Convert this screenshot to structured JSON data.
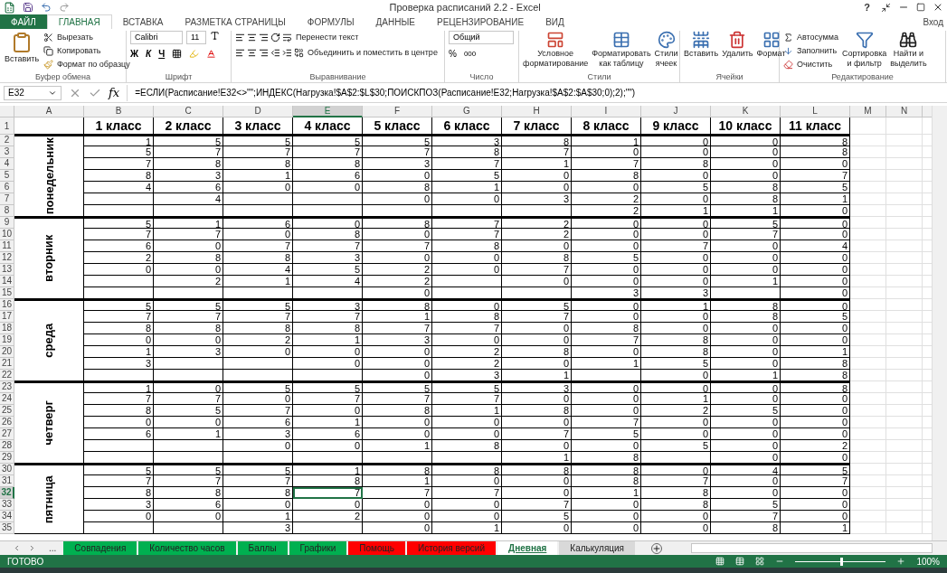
{
  "window": {
    "title": "Проверка расписаний 2.2 - Excel",
    "help": "?"
  },
  "ribbon_tabs": [
    {
      "label": "ФАЙЛ",
      "kind": "file",
      "selected": false
    },
    {
      "label": "ГЛАВНАЯ",
      "kind": "tab",
      "selected": true
    },
    {
      "label": "ВСТАВКА",
      "kind": "tab",
      "selected": false
    },
    {
      "label": "РАЗМЕТКА СТРАНИЦЫ",
      "kind": "tab",
      "selected": false
    },
    {
      "label": "ФОРМУЛЫ",
      "kind": "tab",
      "selected": false
    },
    {
      "label": "ДАННЫЕ",
      "kind": "tab",
      "selected": false
    },
    {
      "label": "РЕЦЕНЗИРОВАНИЕ",
      "kind": "tab",
      "selected": false
    },
    {
      "label": "ВИД",
      "kind": "tab",
      "selected": false
    }
  ],
  "sign_in": "Вход",
  "clipboard": {
    "title": "Буфер обмена",
    "paste": "Вставить",
    "cut": "Вырезать",
    "copy": "Копировать",
    "format_painter": "Формат по образцу"
  },
  "font": {
    "title": "Шрифт",
    "name": "Calibri",
    "size": "11",
    "bold": "Ж",
    "italic": "К",
    "underline": "Ч"
  },
  "alignment": {
    "title": "Выравнивание",
    "wrap": "Перенести текст",
    "merge": "Объединить и поместить в центре"
  },
  "number": {
    "title": "Число",
    "format": "Общий",
    "percent": "%",
    "thousands": "000"
  },
  "styles": {
    "title": "Стили",
    "buttons": [
      {
        "lines": [
          "Условное",
          "форматирование"
        ]
      },
      {
        "lines": [
          "Форматировать",
          "как таблицу"
        ]
      },
      {
        "lines": [
          "Стили",
          "ячеек"
        ]
      }
    ]
  },
  "cells": {
    "title": "Ячейки",
    "buttons": [
      {
        "label": "Вставить"
      },
      {
        "label": "Удалить"
      },
      {
        "label": "Формат"
      }
    ]
  },
  "editing": {
    "title": "Редактирование",
    "autosum": "Автосумма",
    "fill": "Заполнить",
    "clear": "Очистить",
    "buttons": [
      {
        "lines": [
          "Сортировка",
          "и фильтр"
        ]
      },
      {
        "lines": [
          "Найти и",
          "выделить"
        ]
      }
    ]
  },
  "formula_bar": {
    "name_box": "E32",
    "fx": "fx",
    "formula": "=ЕСЛИ(Расписание!E32<>\"\";ИНДЕКС(Нагрузка!$A$2:$L$30;ПОИСКПОЗ(Расписание!E32;Нагрузка!$A$2:$A$30;0);2);\"\")"
  },
  "columns": [
    {
      "label": "A",
      "selected": false
    },
    {
      "label": "B",
      "selected": false
    },
    {
      "label": "C",
      "selected": false
    },
    {
      "label": "D",
      "selected": false
    },
    {
      "label": "E",
      "selected": true
    },
    {
      "label": "F",
      "selected": false
    },
    {
      "label": "G",
      "selected": false
    },
    {
      "label": "H",
      "selected": false
    },
    {
      "label": "I",
      "selected": false
    },
    {
      "label": "J",
      "selected": false
    },
    {
      "label": "K",
      "selected": false
    },
    {
      "label": "L",
      "selected": false
    },
    {
      "label": "M",
      "selected": false
    },
    {
      "label": "N",
      "selected": false
    }
  ],
  "header_row": {
    "n": "1",
    "cells": [
      "1 класс",
      "2 класс",
      "3 класс",
      "4 класс",
      "5 класс",
      "6 класс",
      "7 класс",
      "8 класс",
      "9 класс",
      "10 класс",
      "11 класс"
    ]
  },
  "days": [
    {
      "day": "понедельник",
      "rows": [
        {
          "n": "2",
          "selected": false,
          "cells": [
            "1",
            "5",
            "5",
            "5",
            "5",
            "3",
            "8",
            "1",
            "0",
            "0",
            "8"
          ]
        },
        {
          "n": "3",
          "selected": false,
          "cells": [
            "5",
            "7",
            "7",
            "7",
            "7",
            "8",
            "7",
            "0",
            "0",
            "0",
            "8"
          ]
        },
        {
          "n": "4",
          "selected": false,
          "cells": [
            "7",
            "8",
            "8",
            "8",
            "3",
            "7",
            "1",
            "7",
            "8",
            "0",
            "0"
          ]
        },
        {
          "n": "5",
          "selected": false,
          "cells": [
            "8",
            "3",
            "1",
            "6",
            "0",
            "5",
            "0",
            "8",
            "0",
            "0",
            "7"
          ]
        },
        {
          "n": "6",
          "selected": false,
          "cells": [
            "4",
            "6",
            "0",
            "0",
            "8",
            "1",
            "0",
            "0",
            "5",
            "8",
            "5"
          ]
        },
        {
          "n": "7",
          "selected": false,
          "cells": [
            null,
            "4",
            null,
            null,
            "0",
            "0",
            "3",
            "2",
            "0",
            "8",
            "1"
          ]
        },
        {
          "n": "8",
          "selected": false,
          "cells": [
            null,
            null,
            null,
            null,
            null,
            null,
            null,
            "2",
            "1",
            "1",
            "0"
          ]
        }
      ]
    },
    {
      "day": "вторник",
      "rows": [
        {
          "n": "9",
          "selected": false,
          "cells": [
            "5",
            "1",
            "6",
            "0",
            "8",
            "7",
            "2",
            "0",
            "0",
            "5",
            "0"
          ]
        },
        {
          "n": "10",
          "selected": false,
          "cells": [
            "7",
            "7",
            "0",
            "8",
            "0",
            "7",
            "2",
            "0",
            "0",
            "7",
            "0"
          ]
        },
        {
          "n": "11",
          "selected": false,
          "cells": [
            "6",
            "0",
            "7",
            "7",
            "7",
            "8",
            "0",
            "0",
            "7",
            "0",
            "4"
          ]
        },
        {
          "n": "12",
          "selected": false,
          "cells": [
            "2",
            "8",
            "8",
            "3",
            "0",
            "0",
            "8",
            "5",
            "0",
            "0",
            "0"
          ]
        },
        {
          "n": "13",
          "selected": false,
          "cells": [
            "0",
            "0",
            "4",
            "5",
            "2",
            "0",
            "7",
            "0",
            "0",
            "0",
            "0"
          ]
        },
        {
          "n": "14",
          "selected": false,
          "cells": [
            null,
            "2",
            "1",
            "4",
            "2",
            null,
            "0",
            "0",
            "0",
            "1",
            "0"
          ]
        },
        {
          "n": "15",
          "selected": false,
          "cells": [
            null,
            null,
            null,
            null,
            "0",
            null,
            null,
            "3",
            "3",
            null,
            "0"
          ]
        }
      ]
    },
    {
      "day": "среда",
      "rows": [
        {
          "n": "16",
          "selected": false,
          "cells": [
            "5",
            "5",
            "5",
            "3",
            "8",
            "0",
            "5",
            "0",
            "1",
            "8",
            "0"
          ]
        },
        {
          "n": "17",
          "selected": false,
          "cells": [
            "7",
            "7",
            "7",
            "7",
            "1",
            "8",
            "7",
            "0",
            "0",
            "8",
            "5"
          ]
        },
        {
          "n": "18",
          "selected": false,
          "cells": [
            "8",
            "8",
            "8",
            "8",
            "7",
            "7",
            "0",
            "8",
            "0",
            "0",
            "0"
          ]
        },
        {
          "n": "19",
          "selected": false,
          "cells": [
            "0",
            "0",
            "2",
            "1",
            "3",
            "0",
            "0",
            "7",
            "8",
            "0",
            "0"
          ]
        },
        {
          "n": "20",
          "selected": false,
          "cells": [
            "1",
            "3",
            "0",
            "0",
            "0",
            "2",
            "8",
            "0",
            "8",
            "0",
            "1"
          ]
        },
        {
          "n": "21",
          "selected": false,
          "cells": [
            "3",
            null,
            null,
            "0",
            "0",
            "2",
            "0",
            "1",
            "5",
            "0",
            "8"
          ]
        },
        {
          "n": "22",
          "selected": false,
          "cells": [
            null,
            null,
            null,
            null,
            "0",
            "3",
            "1",
            null,
            "0",
            "1",
            "8"
          ]
        }
      ]
    },
    {
      "day": "четверг",
      "rows": [
        {
          "n": "23",
          "selected": false,
          "cells": [
            "1",
            "0",
            "5",
            "5",
            "5",
            "5",
            "3",
            "0",
            "0",
            "0",
            "8"
          ]
        },
        {
          "n": "24",
          "selected": false,
          "cells": [
            "7",
            "7",
            "0",
            "7",
            "7",
            "7",
            "0",
            "0",
            "1",
            "0",
            "0"
          ]
        },
        {
          "n": "25",
          "selected": false,
          "cells": [
            "8",
            "5",
            "7",
            "0",
            "8",
            "1",
            "8",
            "0",
            "2",
            "5",
            "0"
          ]
        },
        {
          "n": "26",
          "selected": false,
          "cells": [
            "0",
            "0",
            "6",
            "1",
            "0",
            "0",
            "0",
            "7",
            "0",
            "0",
            "0"
          ]
        },
        {
          "n": "27",
          "selected": false,
          "cells": [
            "6",
            "1",
            "3",
            "6",
            "0",
            "0",
            "7",
            "5",
            "0",
            "0",
            "0"
          ]
        },
        {
          "n": "28",
          "selected": false,
          "cells": [
            null,
            null,
            "0",
            "0",
            "1",
            "8",
            "0",
            "0",
            "5",
            "0",
            "2"
          ]
        },
        {
          "n": "29",
          "selected": false,
          "cells": [
            null,
            null,
            null,
            null,
            null,
            null,
            "1",
            "8",
            null,
            "0",
            "0"
          ]
        }
      ]
    },
    {
      "day": "пятница",
      "rows": [
        {
          "n": "30",
          "selected": false,
          "cells": [
            "5",
            "5",
            "5",
            "1",
            "8",
            "8",
            "8",
            "8",
            "0",
            "4",
            "5"
          ]
        },
        {
          "n": "31",
          "selected": false,
          "cells": [
            "7",
            "7",
            "7",
            "8",
            "1",
            "0",
            "0",
            "8",
            "7",
            "0",
            "7"
          ]
        },
        {
          "n": "32",
          "selected": true,
          "cells": [
            "8",
            "8",
            "8",
            "7",
            "7",
            "7",
            "0",
            "1",
            "8",
            "0",
            "0"
          ]
        },
        {
          "n": "33",
          "selected": false,
          "cells": [
            "3",
            "6",
            "0",
            "0",
            "0",
            "0",
            "7",
            "0",
            "8",
            "5",
            "0"
          ]
        },
        {
          "n": "34",
          "selected": false,
          "cells": [
            "0",
            "0",
            "1",
            "2",
            "0",
            "0",
            "5",
            "0",
            "0",
            "7",
            "0"
          ]
        },
        {
          "n": "35",
          "selected": false,
          "cells": [
            null,
            null,
            "3",
            null,
            "0",
            "1",
            "0",
            "0",
            "0",
            "8",
            "1"
          ]
        }
      ]
    }
  ],
  "sheet_nav": "...",
  "sheet_tabs": [
    {
      "label": "Совпадения",
      "color": "#00b050",
      "selected": false
    },
    {
      "label": "Количество часов",
      "color": "#00b050",
      "selected": false
    },
    {
      "label": "Баллы",
      "color": "#00b050",
      "selected": false
    },
    {
      "label": "Графики",
      "color": "#00b050",
      "selected": false
    },
    {
      "label": "Помощь",
      "color": "#ff0000",
      "selected": false
    },
    {
      "label": "История версий",
      "color": "#ff0000",
      "selected": false
    },
    {
      "label": "Дневная",
      "color": "#ffffff",
      "selected": true
    },
    {
      "label": "Калькуляция",
      "color": "#d9d9d9",
      "selected": false
    }
  ],
  "status_bar": {
    "status": "ГОТОВО",
    "zoom": "100%",
    "zoom_level": {
      "level": 0.5
    }
  }
}
